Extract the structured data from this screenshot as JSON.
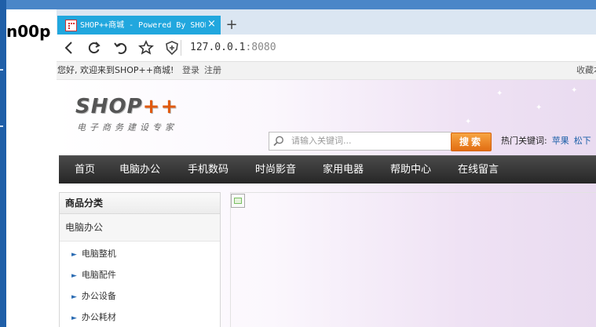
{
  "window": {
    "brand": "n00p"
  },
  "tab": {
    "title": "SHOP++商城 - Powered By SHOP++",
    "close": "×",
    "new_tab": "+"
  },
  "address": {
    "host": "127.0.0.1",
    "port": ":8080"
  },
  "topbar": {
    "welcome": "您好, 欢迎来到SHOP++商城!",
    "login": "登录",
    "register": "注册",
    "favorite": "收藏本站"
  },
  "logo": {
    "name": "SHOP",
    "plus": "++",
    "tagline": "电子商务建设专家"
  },
  "search": {
    "placeholder": "请输入关键词...",
    "button": "搜索"
  },
  "hot_keywords": {
    "label": "热门关键词:",
    "items": [
      "苹果",
      "松下"
    ]
  },
  "nav": {
    "items": [
      "首页",
      "电脑办公",
      "手机数码",
      "时尚影音",
      "家用电器",
      "帮助中心",
      "在线留言"
    ]
  },
  "sidebar": {
    "title": "商品分类",
    "category": "电脑办公",
    "subitems": [
      "电脑整机",
      "电脑配件",
      "办公设备",
      "办公耗材"
    ]
  },
  "icons": {
    "back": "back-arrow-icon",
    "reload": "reload-icon",
    "undo": "undo-icon",
    "bookmark": "star-icon",
    "shield": "shield-icon",
    "search": "magnifier-icon"
  },
  "colors": {
    "tab_active": "#21a7de",
    "nav_bg": "#2d2d2d",
    "search_button": "#f08a24",
    "link": "#1b5fa8"
  }
}
